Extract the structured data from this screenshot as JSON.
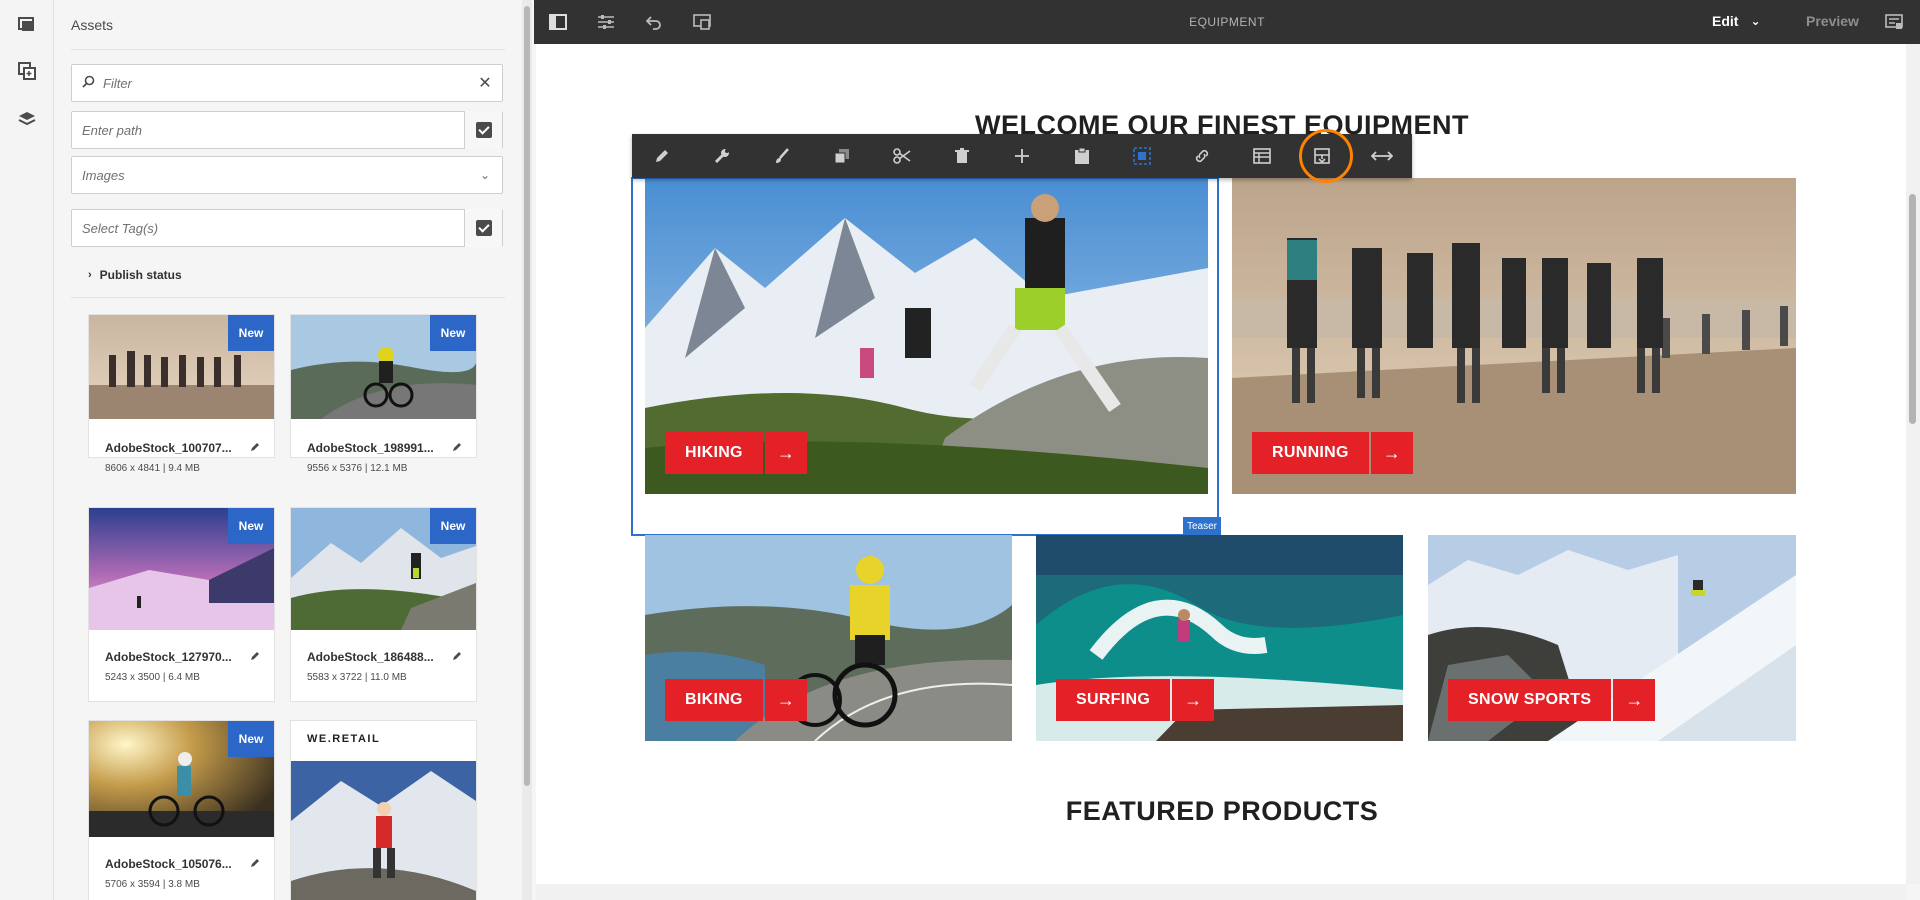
{
  "panel": {
    "title": "Assets",
    "filter_placeholder": "Filter",
    "path_placeholder": "Enter path",
    "type_select": "Images",
    "tags_placeholder": "Select Tag(s)",
    "publish_status": "Publish status"
  },
  "assets": [
    {
      "name": "AdobeStock_100707...",
      "meta": "8606 x 4841 | 9.4 MB",
      "badge": "New"
    },
    {
      "name": "AdobeStock_198991...",
      "meta": "9556 x 5376 | 12.1 MB",
      "badge": "New"
    },
    {
      "name": "AdobeStock_127970...",
      "meta": "5243 x 3500 | 6.4 MB",
      "badge": "New"
    },
    {
      "name": "AdobeStock_186488...",
      "meta": "5583 x 3722 | 11.0 MB",
      "badge": "New"
    },
    {
      "name": "AdobeStock_105076...",
      "meta": "5706 x 3594 | 3.8 MB",
      "badge": "New"
    },
    {
      "name": "",
      "meta": "",
      "badge": "",
      "logo_text": "WE.RETAIL"
    }
  ],
  "topbar": {
    "page_title": "EQUIPMENT",
    "mode": "Edit",
    "preview": "Preview"
  },
  "page": {
    "heading": "WELCOME OUR FINEST EQUIPMENT",
    "featured": "FEATURED PRODUCTS",
    "selected_component": "Teaser",
    "teasers": [
      {
        "label": "HIKING"
      },
      {
        "label": "RUNNING"
      },
      {
        "label": "BIKING"
      },
      {
        "label": "SURFING"
      },
      {
        "label": "SNOW SPORTS"
      }
    ]
  },
  "colors": {
    "accent_red": "#e32127",
    "selection_blue": "#2d73cd",
    "highlight_orange": "#ff8200",
    "badge_blue": "#2c66c7"
  },
  "edit_toolbar_icons": [
    "edit-icon",
    "configure-icon",
    "style-icon",
    "copy-icon",
    "cut-icon",
    "delete-icon",
    "insert-icon",
    "paste-icon",
    "group-icon",
    "parent-icon",
    "layout-icon",
    "convert-icon",
    "resize-icon"
  ]
}
